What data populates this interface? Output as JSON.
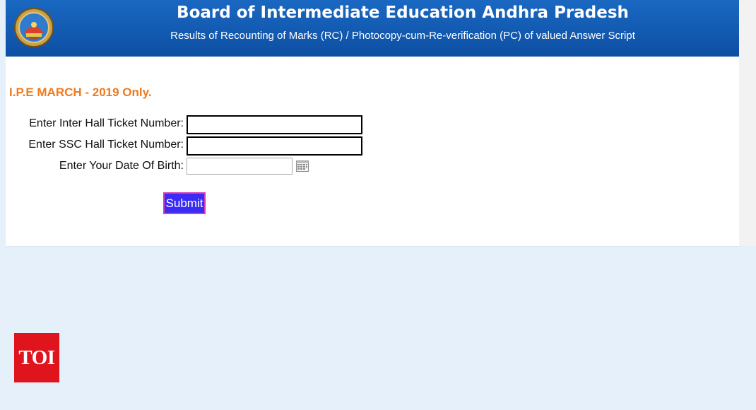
{
  "header": {
    "title": "Board of Intermediate Education Andhra Pradesh",
    "subtitle": "Results of  Recounting of Marks (RC) / Photocopy-cum-Re-verification (PC) of valued Answer Script"
  },
  "form": {
    "exam_label": "I.P.E MARCH - 2019 Only.",
    "inter_hall_ticket": {
      "label": "Enter Inter Hall Ticket Number:",
      "value": "",
      "placeholder": ""
    },
    "ssc_hall_ticket": {
      "label": "Enter SSC Hall Ticket Number:",
      "value": "",
      "placeholder": ""
    },
    "date_of_birth": {
      "label": "Enter Your Date Of Birth:",
      "value": "",
      "placeholder": ""
    },
    "submit_label": "Submit"
  },
  "watermark": {
    "logo_text": "TOI"
  },
  "colors": {
    "header_bg": "#0d4fa3",
    "exam_label": "#f07a1c",
    "submit_bg": "#3b2cf5",
    "submit_border": "#d63bb8",
    "page_bg": "#e6f0fa",
    "toi_red": "#e0141d"
  },
  "icons": {
    "emblem": "state-emblem-icon",
    "calendar": "calendar-icon"
  }
}
